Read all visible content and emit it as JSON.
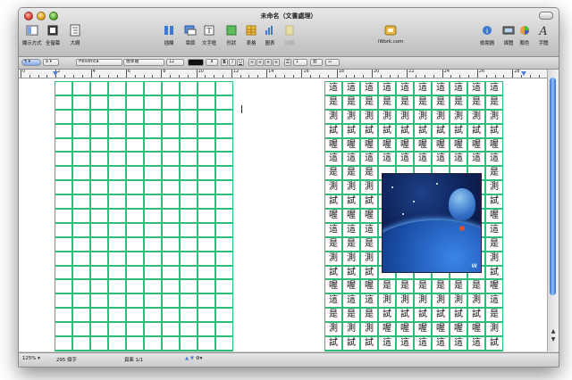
{
  "window": {
    "title": "未命名（文書處理）"
  },
  "toolbar": {
    "items": [
      {
        "label": "顯示方式",
        "icon": "view-icon"
      },
      {
        "label": "全螢幕",
        "icon": "fullscreen-icon"
      },
      {
        "label": "大綱",
        "icon": "outline-icon"
      },
      {
        "label": "插欄",
        "icon": "column-icon"
      },
      {
        "label": "章節",
        "icon": "section-icon"
      },
      {
        "label": "文字框",
        "icon": "textbox-icon"
      },
      {
        "label": "形狀",
        "icon": "shape-icon"
      },
      {
        "label": "表格",
        "icon": "table-icon"
      },
      {
        "label": "圖表",
        "icon": "chart-icon"
      },
      {
        "label": "註解",
        "icon": "comment-icon",
        "disabled": true
      },
      {
        "label": "iWork.com",
        "icon": "iwork-icon"
      },
      {
        "label": "檢閱器",
        "icon": "inspector-icon"
      },
      {
        "label": "媒體",
        "icon": "media-icon"
      },
      {
        "label": "顏色",
        "icon": "colors-icon"
      },
      {
        "label": "字體",
        "icon": "fonts-icon"
      }
    ]
  },
  "format_bar": {
    "style_a": "a",
    "font_family": "Helvetica",
    "font_style": "標準體",
    "font_size": "12",
    "text_color": "a",
    "bold": "B",
    "italic": "I",
    "underline": "U",
    "line_spacing": "1"
  },
  "ruler": {
    "labels": [
      "0",
      "2",
      "4",
      "6",
      "8",
      "10",
      "12",
      "14",
      "16",
      "18",
      "20",
      "22",
      "24",
      "26",
      "28"
    ]
  },
  "document": {
    "char_rows": [
      [
        "這",
        "這",
        "這",
        "這",
        "這",
        "這",
        "這",
        "這",
        "這",
        "這"
      ],
      [
        "是",
        "是",
        "是",
        "是",
        "是",
        "是",
        "是",
        "是",
        "是",
        "是"
      ],
      [
        "測",
        "測",
        "測",
        "測",
        "測",
        "測",
        "測",
        "測",
        "測",
        "測"
      ],
      [
        "試",
        "試",
        "試",
        "試",
        "試",
        "試",
        "試",
        "試",
        "試",
        "試"
      ],
      [
        "喔",
        "喔",
        "喔",
        "喔",
        "喔",
        "喔",
        "喔",
        "喔",
        "喔",
        "喔"
      ],
      [
        "這",
        "這",
        "這",
        "這",
        "這",
        "這",
        "這",
        "這",
        "這",
        "這"
      ],
      [
        "是",
        "是",
        "是",
        "",
        "",
        "",
        "",
        "",
        "",
        "是"
      ],
      [
        "測",
        "測",
        "測",
        "",
        "",
        "",
        "",
        "",
        "",
        "測"
      ],
      [
        "試",
        "試",
        "試",
        "",
        "",
        "",
        "",
        "",
        "",
        "試"
      ],
      [
        "喔",
        "喔",
        "喔",
        "",
        "",
        "",
        "",
        "",
        "",
        "喔"
      ],
      [
        "這",
        "這",
        "這",
        "",
        "",
        "",
        "",
        "",
        "",
        "這"
      ],
      [
        "是",
        "是",
        "是",
        "",
        "",
        "",
        "",
        "",
        "",
        "是"
      ],
      [
        "測",
        "測",
        "測",
        "",
        "",
        "",
        "",
        "",
        "",
        "測"
      ],
      [
        "試",
        "試",
        "試",
        "",
        "",
        "",
        "",
        "",
        "",
        "試"
      ],
      [
        "喔",
        "喔",
        "喔",
        "是",
        "是",
        "是",
        "是",
        "是",
        "是",
        "喔"
      ],
      [
        "這",
        "這",
        "這",
        "測",
        "測",
        "測",
        "測",
        "測",
        "測",
        "這"
      ],
      [
        "是",
        "是",
        "是",
        "試",
        "試",
        "試",
        "試",
        "試",
        "試",
        "是"
      ],
      [
        "測",
        "測",
        "測",
        "喔",
        "喔",
        "喔",
        "喔",
        "喔",
        "喔",
        "測"
      ],
      [
        "試",
        "試",
        "試",
        "這",
        "這",
        "這",
        "這",
        "這",
        "這",
        "試"
      ],
      [
        "喔",
        "喔",
        "喔",
        "是",
        "是",
        "是",
        "是",
        "是",
        "是",
        "喔"
      ]
    ],
    "image_watermark": "W"
  },
  "status": {
    "zoom": "125%",
    "word_count": "295 個字",
    "page": "頁面 1/1"
  }
}
